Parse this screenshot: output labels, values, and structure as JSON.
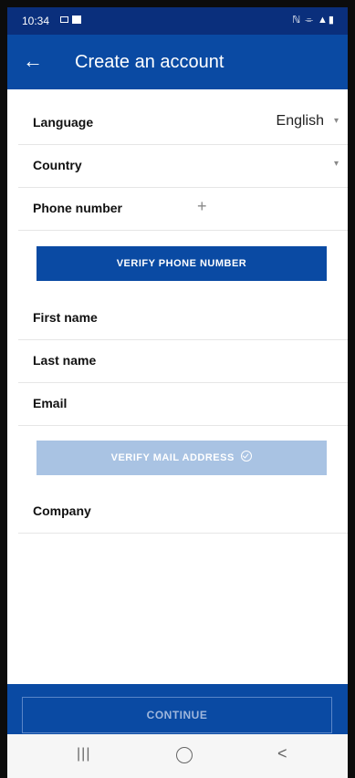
{
  "status_bar": {
    "time": "10:34",
    "right_icons": "ℕ ⌯ ▲▮"
  },
  "header": {
    "title": "Create an account"
  },
  "form": {
    "language": {
      "label": "Language",
      "value": "English"
    },
    "country": {
      "label": "Country"
    },
    "phone": {
      "label": "Phone number",
      "prefix": "+"
    },
    "verify_phone_label": "VERIFY PHONE NUMBER",
    "first_name": {
      "label": "First name"
    },
    "last_name": {
      "label": "Last name"
    },
    "email": {
      "label": "Email"
    },
    "verify_mail_label": "VERIFY MAIL ADDRESS",
    "company": {
      "label": "Company"
    }
  },
  "footer": {
    "continue_label": "CONTINUE"
  },
  "navbar": {
    "recents_glyph": "|||",
    "back_glyph": "<"
  },
  "colors": {
    "primary": "#0a4aa3",
    "status_bar": "#0a2f7c",
    "disabled_button": "#a9c3e3"
  }
}
